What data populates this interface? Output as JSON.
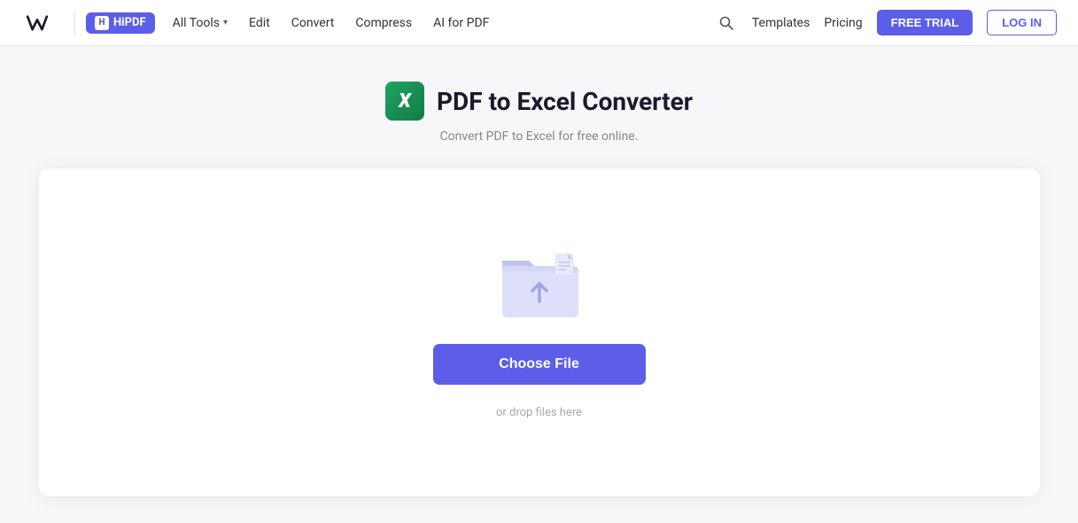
{
  "nav": {
    "brand": "Wondershare",
    "product": "HiPDF",
    "links": [
      {
        "label": "All Tools",
        "has_dropdown": true
      },
      {
        "label": "Edit",
        "has_dropdown": false
      },
      {
        "label": "Convert",
        "has_dropdown": false
      },
      {
        "label": "Compress",
        "has_dropdown": false
      },
      {
        "label": "AI for PDF",
        "has_dropdown": false
      }
    ],
    "right_links": [
      {
        "label": "Templates"
      },
      {
        "label": "Pricing"
      }
    ],
    "cta_label": "FREE TRIAL",
    "login_label": "LOG IN"
  },
  "page": {
    "icon_letter": "X",
    "title": "PDF to Excel Converter",
    "subtitle": "Convert PDF to Excel for free online.",
    "choose_file_label": "Choose File",
    "drop_hint": "or drop files here"
  }
}
